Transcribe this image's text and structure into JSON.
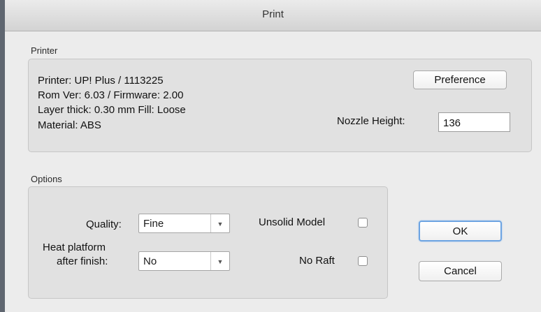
{
  "window": {
    "title": "Print"
  },
  "printer": {
    "group_label": "Printer",
    "info_lines": [
      "Printer: UP! Plus / 1113225",
      "Rom Ver: 6.03 / Firmware: 2.00",
      "Layer thick: 0.30 mm  Fill: Loose",
      "Material: ABS"
    ],
    "preference_button": "Preference",
    "nozzle_height_label": "Nozzle Height:",
    "nozzle_height_value": "136"
  },
  "options": {
    "group_label": "Options",
    "quality_label": "Quality:",
    "quality_value": "Fine",
    "heat_platform_label_line1": "Heat platform",
    "heat_platform_label_line2": "after finish:",
    "heat_platform_value": "No",
    "unsolid_model_label": "Unsolid Model",
    "unsolid_model_checked": false,
    "no_raft_label": "No Raft",
    "no_raft_checked": false
  },
  "buttons": {
    "ok": "OK",
    "cancel": "Cancel"
  },
  "icons": {
    "dropdown": "chevron-down-icon",
    "dropdown_glyph": "▼"
  }
}
